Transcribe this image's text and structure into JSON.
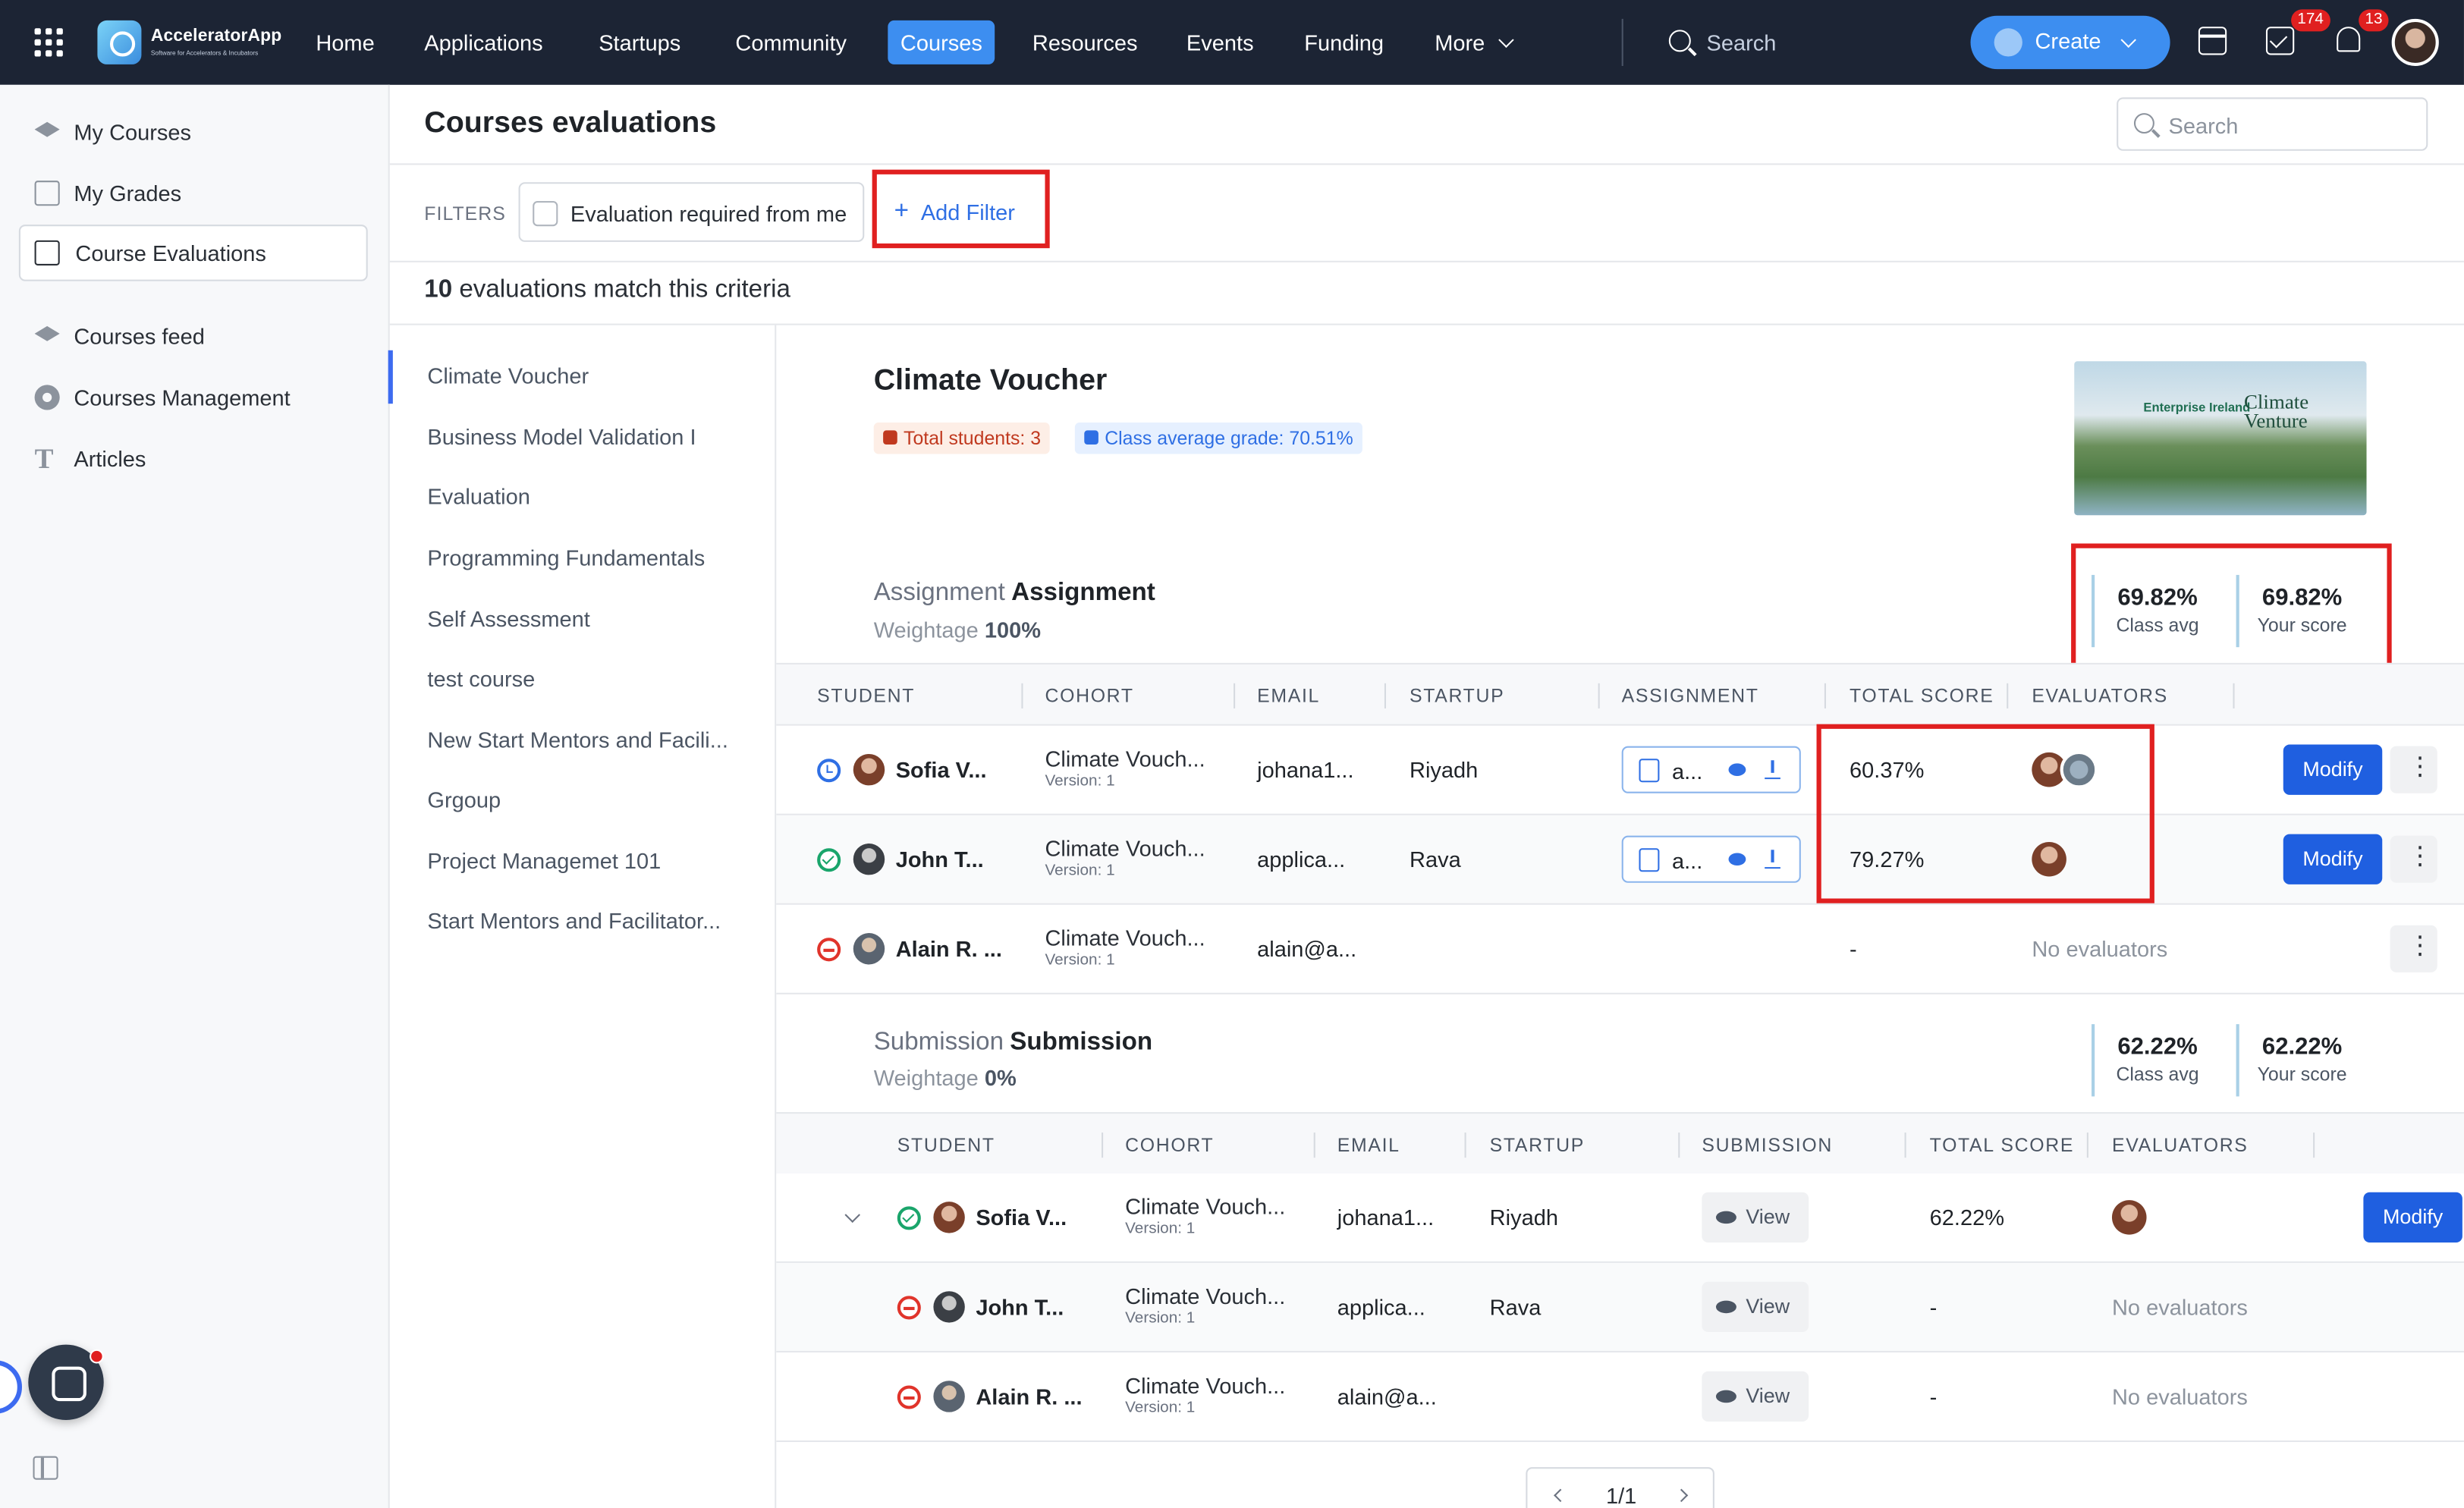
{
  "app": {
    "brand_name": "AcceleratorApp",
    "brand_tagline": "Software for Accelerators & Incubators"
  },
  "topnav": {
    "items": [
      "Home",
      "Applications",
      "Startups",
      "Community",
      "Courses",
      "Resources",
      "Events",
      "Funding",
      "More"
    ],
    "active": "Courses",
    "search_placeholder": "Search",
    "create_label": "Create",
    "tasks_badge": "174",
    "notifications_badge": "13",
    "icons": [
      "apps-grid-icon",
      "calendar-icon",
      "tasks-check-icon",
      "bell-icon"
    ]
  },
  "sidebar": {
    "items": [
      {
        "label": "My Courses",
        "icon": "graduation-cap-icon"
      },
      {
        "label": "My Grades",
        "icon": "edit-icon"
      },
      {
        "label": "Course Evaluations",
        "icon": "edit-icon",
        "active": true
      },
      {
        "label": "Courses feed",
        "icon": "graduation-cap-icon"
      },
      {
        "label": "Courses Management",
        "icon": "gear-icon"
      },
      {
        "label": "Articles",
        "icon": "text-icon"
      }
    ]
  },
  "page": {
    "title": "Courses evaluations",
    "search_placeholder": "Search",
    "filters_label": "FILTERS",
    "filter_checkbox_label": "Evaluation required from me",
    "add_filter_label": "Add Filter",
    "match_count": "10",
    "match_text": "evaluations match this criteria"
  },
  "courses": [
    "Climate Voucher",
    "Business Model Validation I",
    "Evaluation",
    "Programming Fundamentals",
    "Self Assessment",
    "test course",
    "New Start Mentors and Facili...",
    "Grgoup",
    "Project Managemet 101",
    "Start Mentors and Facilitator..."
  ],
  "course": {
    "title": "Climate Voucher",
    "total_students": "Total students: 3",
    "class_average": "Class average grade: 70.51%",
    "image_text_1": "Enterprise Ireland",
    "image_text_2": "Climate Venture"
  },
  "assignment": {
    "type_label": "Assignment",
    "name": "Assignment",
    "weightage_label": "Weightage",
    "weightage_value": "100%",
    "class_avg_value": "69.82%",
    "class_avg_label": "Class avg",
    "your_score_value": "69.82%",
    "your_score_label": "Your score",
    "headers": [
      "STUDENT",
      "COHORT",
      "EMAIL",
      "STARTUP",
      "ASSIGNMENT",
      "TOTAL SCORE",
      "EVALUATORS"
    ],
    "rows": [
      {
        "status": "pending",
        "student": "Sofia V...",
        "cohort": "Climate Vouch...",
        "version": "Version: 1",
        "email": "johana1...",
        "startup": "Riyadh",
        "assignment": "a...",
        "score": "60.37%",
        "evaluators": "",
        "action": "Modify"
      },
      {
        "status": "done",
        "student": "John T...",
        "cohort": "Climate Vouch...",
        "version": "Version: 1",
        "email": "applica...",
        "startup": "Rava",
        "assignment": "a...",
        "score": "79.27%",
        "evaluators": "",
        "action": "Modify"
      },
      {
        "status": "none",
        "student": "Alain R. ...",
        "cohort": "Climate Vouch...",
        "version": "Version: 1",
        "email": "alain@a...",
        "startup": "",
        "assignment": "",
        "score": "-",
        "evaluators": "No evaluators",
        "action": ""
      }
    ]
  },
  "submission": {
    "type_label": "Submission",
    "name": "Submission",
    "weightage_label": "Weightage",
    "weightage_value": "0%",
    "class_avg_value": "62.22%",
    "class_avg_label": "Class avg",
    "your_score_value": "62.22%",
    "your_score_label": "Your score",
    "headers": [
      "STUDENT",
      "COHORT",
      "EMAIL",
      "STARTUP",
      "SUBMISSION",
      "TOTAL SCORE",
      "EVALUATORS"
    ],
    "view_label": "View",
    "rows": [
      {
        "status": "done",
        "student": "Sofia V...",
        "cohort": "Climate Vouch...",
        "version": "Version: 1",
        "email": "johana1...",
        "startup": "Riyadh",
        "score": "62.22%",
        "evaluators": "",
        "action": "Modify"
      },
      {
        "status": "none",
        "student": "John T...",
        "cohort": "Climate Vouch...",
        "version": "Version: 1",
        "email": "applica...",
        "startup": "Rava",
        "score": "-",
        "evaluators": "No evaluators",
        "action": ""
      },
      {
        "status": "none",
        "student": "Alain R. ...",
        "cohort": "Climate Vouch...",
        "version": "Version: 1",
        "email": "alain@a...",
        "startup": "",
        "score": "-",
        "evaluators": "No evaluators",
        "action": ""
      }
    ]
  },
  "pagination": {
    "label": "1/1"
  }
}
